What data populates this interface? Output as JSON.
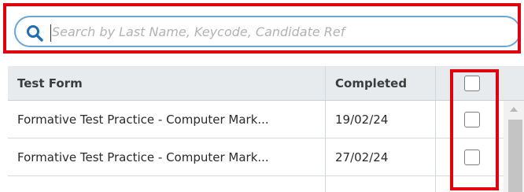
{
  "search": {
    "placeholder": "Search by Last Name, Keycode, Candidate Ref",
    "value": "",
    "icon": "search-icon"
  },
  "table": {
    "columns": [
      "Test Form",
      "Completed",
      ""
    ],
    "rows": [
      {
        "test_form": "Formative Test Practice - Computer Mark...",
        "completed": "19/02/24",
        "checked": false
      },
      {
        "test_form": "Formative Test Practice - Computer Mark...",
        "completed": "27/02/24",
        "checked": false
      }
    ],
    "select_all_checked": false
  },
  "colors": {
    "highlight": "#e0000f",
    "search_border": "#6aa6d8",
    "search_icon": "#1f6fb2",
    "header_bg": "#e7ebee"
  }
}
